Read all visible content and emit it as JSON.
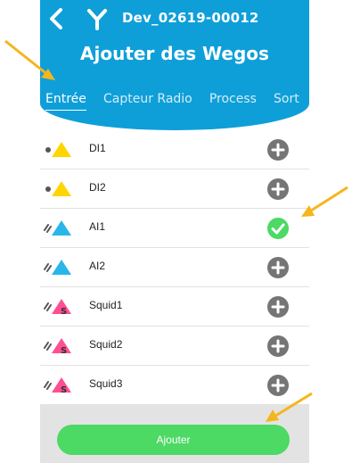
{
  "header": {
    "device_id": "Dev_02619-00012",
    "title": "Ajouter des Wegos",
    "tabs": [
      {
        "label": "Entrée",
        "active": true
      },
      {
        "label": "Capteur Radio",
        "active": false
      },
      {
        "label": "Process",
        "active": false
      },
      {
        "label": "Sort",
        "active": false
      }
    ]
  },
  "items": [
    {
      "label": "DI1",
      "type": "digital-input",
      "selected": false
    },
    {
      "label": "DI2",
      "type": "digital-input",
      "selected": false
    },
    {
      "label": "AI1",
      "type": "analog-input",
      "selected": true
    },
    {
      "label": "AI2",
      "type": "analog-input",
      "selected": false
    },
    {
      "label": "Squid1",
      "type": "squid",
      "selected": false
    },
    {
      "label": "Squid2",
      "type": "squid",
      "selected": false
    },
    {
      "label": "Squid3",
      "type": "squid",
      "selected": false
    }
  ],
  "footer": {
    "add_label": "Ajouter"
  },
  "colors": {
    "header": "#0e9fd9",
    "digital_triangle": "#ffd400",
    "analog_triangle": "#29b6e8",
    "squid_triangle": "#ff4f93",
    "selected_check": "#4cd964",
    "unselected_plus": "#757575",
    "annotation_arrow": "#f5b51c"
  }
}
